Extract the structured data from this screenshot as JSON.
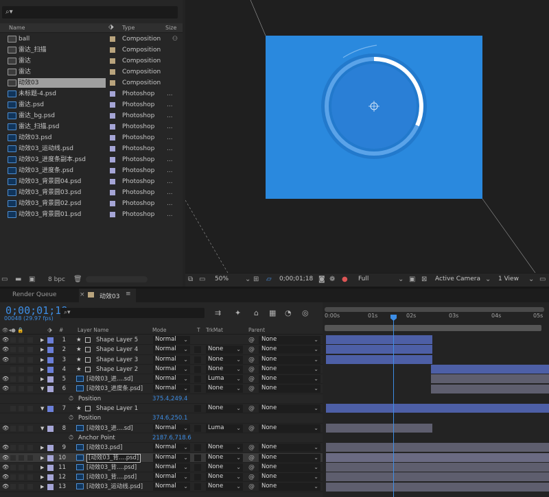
{
  "project": {
    "columns": {
      "name": "Name",
      "type": "Type",
      "size": "Size"
    },
    "items": [
      {
        "name": "ball",
        "type": "Composition",
        "size": "",
        "icon": "composition-icon",
        "label_color": "#b9a47d",
        "selected": false
      },
      {
        "name": "雷达_扫描",
        "type": "Composition",
        "size": "",
        "icon": "composition-icon",
        "label_color": "#b9a47d",
        "selected": false
      },
      {
        "name": "雷达",
        "type": "Composition",
        "size": "",
        "icon": "composition-icon",
        "label_color": "#b9a47d",
        "selected": false
      },
      {
        "name": "雷达",
        "type": "Composition",
        "size": "",
        "icon": "composition-icon",
        "label_color": "#b9a47d",
        "selected": false
      },
      {
        "name": "动效03",
        "type": "Composition",
        "size": "",
        "icon": "composition-icon",
        "label_color": "#b9a47d",
        "selected": true
      },
      {
        "name": "未标题-4.psd",
        "type": "Photoshop",
        "size": "...",
        "icon": "photoshop-file-icon",
        "label_color": "#a5a5d6",
        "selected": false
      },
      {
        "name": "雷达.psd",
        "type": "Photoshop",
        "size": "...",
        "icon": "photoshop-file-icon",
        "label_color": "#a5a5d6",
        "selected": false
      },
      {
        "name": "雷达_bg.psd",
        "type": "Photoshop",
        "size": "...",
        "icon": "photoshop-file-icon",
        "label_color": "#a5a5d6",
        "selected": false
      },
      {
        "name": "雷达_扫描.psd",
        "type": "Photoshop",
        "size": "...",
        "icon": "photoshop-file-icon",
        "label_color": "#a5a5d6",
        "selected": false
      },
      {
        "name": "动效03.psd",
        "type": "Photoshop",
        "size": "...",
        "icon": "photoshop-file-icon",
        "label_color": "#a5a5d6",
        "selected": false
      },
      {
        "name": "动效03_运动线.psd",
        "type": "Photoshop",
        "size": "...",
        "icon": "photoshop-file-icon",
        "label_color": "#a5a5d6",
        "selected": false
      },
      {
        "name": "动效03_进度条副本.psd",
        "type": "Photoshop",
        "size": "...",
        "icon": "photoshop-file-icon",
        "label_color": "#a5a5d6",
        "selected": false
      },
      {
        "name": "动效03_进度条.psd",
        "type": "Photoshop",
        "size": "...",
        "icon": "photoshop-file-icon",
        "label_color": "#a5a5d6",
        "selected": false
      },
      {
        "name": "动效03_背景圆04.psd",
        "type": "Photoshop",
        "size": "...",
        "icon": "photoshop-file-icon",
        "label_color": "#a5a5d6",
        "selected": false
      },
      {
        "name": "动效03_背景圆03.psd",
        "type": "Photoshop",
        "size": "...",
        "icon": "photoshop-file-icon",
        "label_color": "#a5a5d6",
        "selected": false
      },
      {
        "name": "动效03_背景圆02.psd",
        "type": "Photoshop",
        "size": "...",
        "icon": "photoshop-file-icon",
        "label_color": "#a5a5d6",
        "selected": false
      },
      {
        "name": "动效03_背景圆01.psd",
        "type": "Photoshop",
        "size": "...",
        "icon": "photoshop-file-icon",
        "label_color": "#a5a5d6",
        "selected": false
      }
    ],
    "footer": {
      "bpc": "8 bpc"
    }
  },
  "viewer": {
    "zoom": "50%",
    "timecode": "0;00;01;18",
    "resolution": "Full",
    "camera": "Active Camera",
    "views": "1 View"
  },
  "tabs": {
    "render_queue": "Render Queue",
    "comp": "动效03"
  },
  "timeline": {
    "timecode": "0;00;01;18",
    "frames": "00048 (29.97 fps)",
    "columns": {
      "num": "#",
      "layer_name": "Layer Name",
      "mode": "Mode",
      "t": "T",
      "trkmat": "TrkMat",
      "parent": "Parent"
    },
    "ruler_ticks": [
      "0:00s",
      "01s",
      "02s",
      "03s",
      "04s",
      "05s"
    ],
    "layers": [
      {
        "kind": "layer",
        "num": "1",
        "name": "Shape Layer 5",
        "type": "shape",
        "mode": "Normal",
        "trkmat": "",
        "parent": "None",
        "visible": true,
        "label_color": "#6b7fd8",
        "expanded": false
      },
      {
        "kind": "layer",
        "num": "2",
        "name": "Shape Layer 4",
        "type": "shape",
        "mode": "Normal",
        "trkmat": "None",
        "parent": "None",
        "visible": true,
        "label_color": "#6b7fd8",
        "expanded": false
      },
      {
        "kind": "layer",
        "num": "3",
        "name": "Shape Layer 3",
        "type": "shape",
        "mode": "Normal",
        "trkmat": "None",
        "parent": "None",
        "visible": true,
        "label_color": "#6b7fd8",
        "expanded": false
      },
      {
        "kind": "layer",
        "num": "4",
        "name": "Shape Layer 2",
        "type": "shape",
        "mode": "Normal",
        "trkmat": "None",
        "parent": "None",
        "visible": false,
        "label_color": "#6b7fd8",
        "expanded": false
      },
      {
        "kind": "layer",
        "num": "5",
        "name": "[动效03_进....sd]",
        "type": "footage",
        "mode": "Normal",
        "trkmat": "Luma",
        "parent": "None",
        "visible": true,
        "label_color": "#a5a5d6",
        "expanded": false
      },
      {
        "kind": "layer",
        "num": "6",
        "name": "[动效03_进度条.psd]",
        "type": "footage",
        "mode": "Normal",
        "trkmat": "None",
        "parent": "None",
        "visible": true,
        "label_color": "#a5a5d6",
        "expanded": true
      },
      {
        "kind": "prop",
        "name": "Position",
        "value": "375.4,249.4"
      },
      {
        "kind": "layer",
        "num": "7",
        "name": "Shape Layer 1",
        "type": "shape",
        "mode": "",
        "trkmat": "None",
        "parent": "None",
        "visible": false,
        "label_color": "#6b7fd8",
        "expanded": true
      },
      {
        "kind": "prop",
        "name": "Position",
        "value": "374.6,250.1"
      },
      {
        "kind": "layer",
        "num": "8",
        "name": "[动效03_进....sd]",
        "type": "footage",
        "mode": "Normal",
        "trkmat": "Luma",
        "parent": "None",
        "visible": true,
        "label_color": "#a5a5d6",
        "expanded": true
      },
      {
        "kind": "prop",
        "name": "Anchor Point",
        "value": "2187.6,718.6"
      },
      {
        "kind": "layer",
        "num": "9",
        "name": "[动效03.psd]",
        "type": "footage",
        "mode": "Normal",
        "trkmat": "None",
        "parent": "None",
        "visible": true,
        "label_color": "#a5a5d6",
        "expanded": false
      },
      {
        "kind": "layer",
        "num": "10",
        "name": "[动效03_背....psd]",
        "type": "footage",
        "mode": "Normal",
        "trkmat": "None",
        "parent": "None",
        "visible": true,
        "label_color": "#a5a5d6",
        "expanded": false,
        "boxed": true
      },
      {
        "kind": "layer",
        "num": "11",
        "name": "[动效03_背....psd]",
        "type": "footage",
        "mode": "Normal",
        "trkmat": "None",
        "parent": "None",
        "visible": true,
        "label_color": "#a5a5d6",
        "expanded": false
      },
      {
        "kind": "layer",
        "num": "12",
        "name": "[动效03_背....psd]",
        "type": "footage",
        "mode": "Normal",
        "trkmat": "None",
        "parent": "None",
        "visible": true,
        "label_color": "#a5a5d6",
        "expanded": false
      },
      {
        "kind": "layer",
        "num": "13",
        "name": "[动效03_运动线.psd]",
        "type": "footage",
        "mode": "Normal",
        "trkmat": "None",
        "parent": "None",
        "visible": true,
        "label_color": "#a5a5d6",
        "expanded": false
      }
    ]
  },
  "colors": {
    "accent": "#3d8ee6",
    "comp_bg": "#2a89de"
  }
}
